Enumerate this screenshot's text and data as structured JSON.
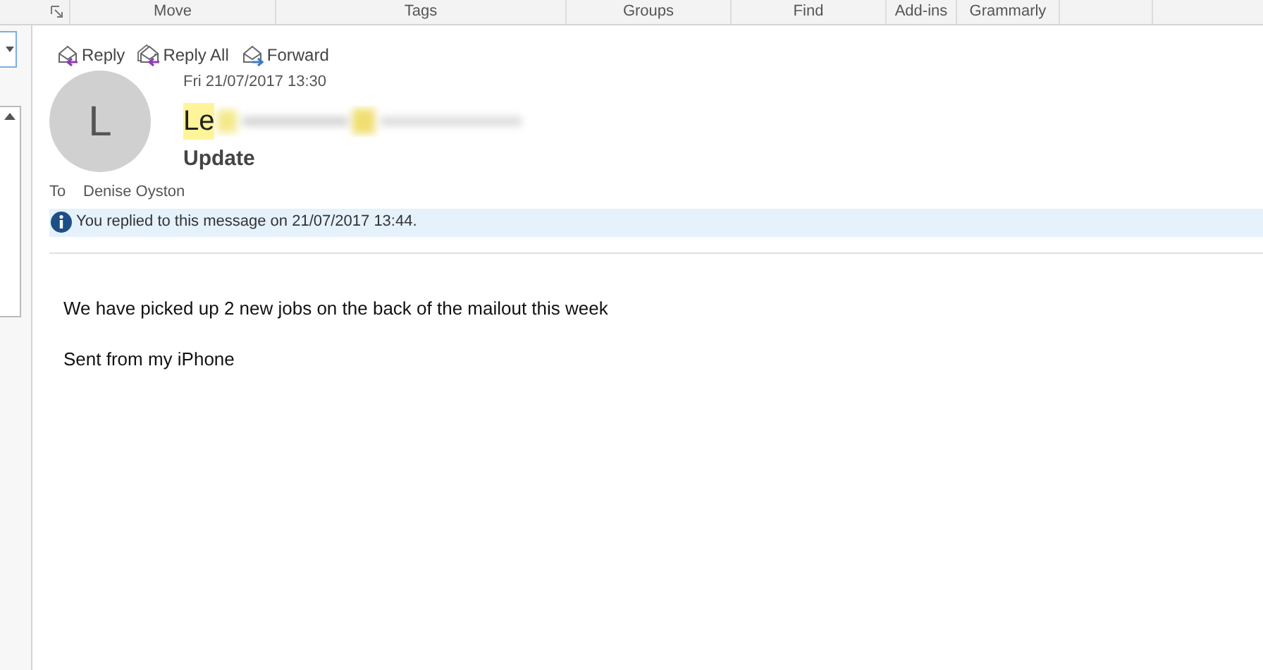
{
  "ribbon_groups": [
    {
      "label": "Move"
    },
    {
      "label": "Tags"
    },
    {
      "label": "Groups"
    },
    {
      "label": "Find"
    },
    {
      "label": "Add-ins"
    },
    {
      "label": "Grammarly"
    }
  ],
  "actions": [
    {
      "label": "Reply",
      "kind": "reply"
    },
    {
      "label": "Reply All",
      "kind": "replyall"
    },
    {
      "label": "Forward",
      "kind": "forward"
    }
  ],
  "message": {
    "avatar_initial": "L",
    "date": "Fri 21/07/2017 13:30",
    "sender_visible": "Le",
    "subject": "Update",
    "to_label": "To",
    "to": "Denise Oyston",
    "info": "You replied to this message on 21/07/2017 13:44.",
    "body": [
      "We have picked up 2 new jobs on the back of the mailout this week",
      "Sent from my iPhone"
    ]
  }
}
